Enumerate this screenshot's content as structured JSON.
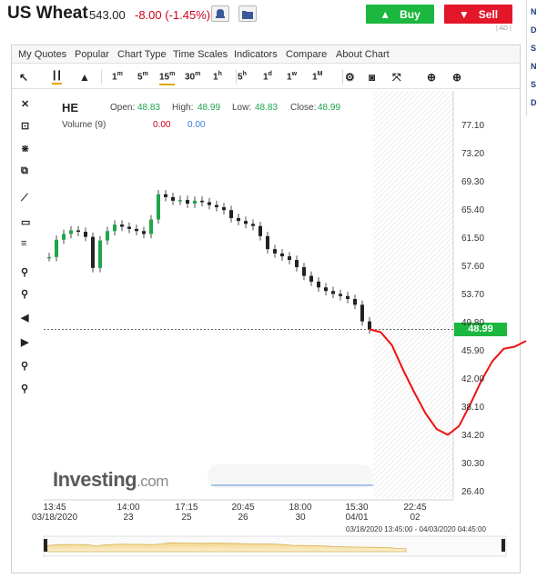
{
  "header": {
    "title": "US Wheat",
    "price": "543.00",
    "change": "-8.00 (-1.45%)",
    "buy_label": "Buy",
    "sell_label": "Sell",
    "ad_label": "| AD |",
    "side_letters": [
      "N",
      "D",
      "S",
      "N",
      "S",
      "D"
    ]
  },
  "menu": {
    "items": [
      "My Quotes",
      "Popular",
      "Chart Type",
      "Time Scales",
      "Indicators",
      "Compare",
      "About Chart"
    ]
  },
  "toolbar": {
    "timescales": [
      {
        "label": "1",
        "sup": "m"
      },
      {
        "label": "5",
        "sup": "m"
      },
      {
        "label": "15",
        "sup": "m"
      },
      {
        "label": "30",
        "sup": "m"
      },
      {
        "label": "1",
        "sup": "h"
      },
      {
        "label": "5",
        "sup": "h"
      },
      {
        "label": "1",
        "sup": "d"
      },
      {
        "label": "1",
        "sup": "w"
      },
      {
        "label": "1",
        "sup": "M"
      }
    ],
    "active_timescale": "15m",
    "icons": [
      "crosshair-icon",
      "candlestick-icon",
      "mountain-icon",
      "gear-icon",
      "camera-icon",
      "fullscreen-icon",
      "download-icon",
      "upload-icon"
    ]
  },
  "left_tools": [
    "close-icon",
    "cursor-zoom-icon",
    "measure-icon",
    "clone-icon",
    "trend-line-icon",
    "rectangle-icon",
    "fib-icon",
    "zoom-in-icon",
    "zoom-out-icon",
    "scroll-left-icon",
    "scroll-right-icon",
    "zoom-reset-icon",
    "magnet-icon"
  ],
  "legend": {
    "symbol": "HE",
    "open_label": "Open:",
    "open": "48.83",
    "high_label": "High:",
    "high": "48.99",
    "low_label": "Low:",
    "low": "48.83",
    "close_label": "Close:",
    "close": "48.99",
    "volume_label": "Volume (9)",
    "vol_a": "0.00",
    "vol_b": "0.00"
  },
  "chart_data": {
    "type": "line",
    "title": "",
    "ylim": [
      24.6,
      79.0
    ],
    "y_ticks": [
      "77.10",
      "73.20",
      "69.30",
      "65.40",
      "61.50",
      "57.60",
      "53.70",
      "49.80",
      "45.90",
      "42.00",
      "38.10",
      "34.20",
      "30.30",
      "26.40"
    ],
    "x_ticks": [
      {
        "time": "13:45",
        "date": "03/18/2020"
      },
      {
        "time": "14:00",
        "date": "23"
      },
      {
        "time": "17:15",
        "date": "25"
      },
      {
        "time": "20:45",
        "date": "26"
      },
      {
        "time": "18:00",
        "date": "30"
      },
      {
        "time": "15:30",
        "date": "04/01"
      },
      {
        "time": "22:45",
        "date": "02"
      }
    ],
    "last_price": "48.99",
    "price_series": [
      59.0,
      61.4,
      62.2,
      62.7,
      62.5,
      61.8,
      57.5,
      61.3,
      62.6,
      63.5,
      63.2,
      62.9,
      62.6,
      62.2,
      64.2,
      67.7,
      67.3,
      66.8,
      66.9,
      66.4,
      66.8,
      66.6,
      66.2,
      65.9,
      65.5,
      64.4,
      64.0,
      63.6,
      63.3,
      61.9,
      60.1,
      59.5,
      59.1,
      58.6,
      57.6,
      56.4,
      55.6,
      54.8,
      54.3,
      53.9,
      53.6,
      53.2,
      52.4,
      50.1,
      48.99
    ],
    "drawn_forecast": [
      48.99,
      48.6,
      46.8,
      43.4,
      40.3,
      37.4,
      35.2,
      34.4,
      35.6,
      38.6,
      41.9,
      44.6,
      46.3,
      46.6,
      47.4
    ]
  },
  "range_label": "03/18/2020 13:45:00 - 04/03/2020 04:45:00",
  "watermark": {
    "brand": "Investing",
    "suffix": ".com"
  }
}
